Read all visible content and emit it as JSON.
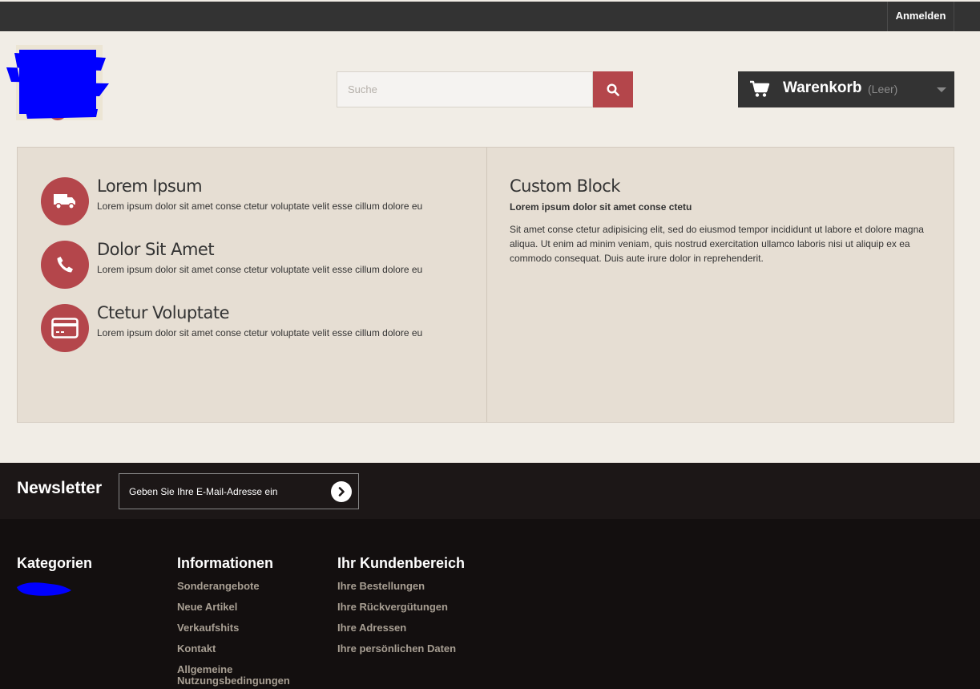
{
  "topbar": {
    "login_label": "Anmelden"
  },
  "search": {
    "placeholder": "Suche"
  },
  "cart": {
    "title": "Warenkorb",
    "status": "(Leer)"
  },
  "features": [
    {
      "icon": "truck-icon",
      "title": "Lorem Ipsum",
      "text": "Lorem ipsum dolor sit amet conse ctetur voluptate velit esse cillum dolore eu"
    },
    {
      "icon": "phone-icon",
      "title": "Dolor Sit Amet",
      "text": "Lorem ipsum dolor sit amet conse ctetur voluptate velit esse cillum dolore eu"
    },
    {
      "icon": "credit-card-icon",
      "title": "Ctetur Voluptate",
      "text": "Lorem ipsum dolor sit amet conse ctetur voluptate velit esse cillum dolore eu"
    }
  ],
  "custom_block": {
    "title": "Custom Block",
    "subtitle": "Lorem ipsum dolor sit amet conse ctetu",
    "text": "Sit amet conse ctetur adipisicing elit, sed do eiusmod tempor incididunt ut labore et dolore magna aliqua. Ut enim ad minim veniam, quis nostrud exercitation ullamco laboris nisi ut aliquip ex ea commodo consequat. Duis aute irure dolor in reprehenderit."
  },
  "newsletter": {
    "title": "Newsletter",
    "placeholder": "Geben Sie Ihre E-Mail-Adresse ein"
  },
  "footer": {
    "categories": {
      "heading": "Kategorien"
    },
    "information": {
      "heading": "Informationen",
      "items": [
        "Sonderangebote",
        "Neue Artikel",
        "Verkaufshits",
        "Kontakt",
        "Allgemeine Nutzungsbedingungen"
      ]
    },
    "account": {
      "heading": "Ihr Kundenbereich",
      "items": [
        "Ihre Bestellungen",
        "Ihre Rückvergütungen",
        "Ihre Adressen",
        "Ihre persönlichen Daten"
      ]
    }
  },
  "colors": {
    "accent": "#b4464b",
    "dark": "#333333",
    "footer": "#130f0f",
    "panel": "#e6ded3"
  }
}
